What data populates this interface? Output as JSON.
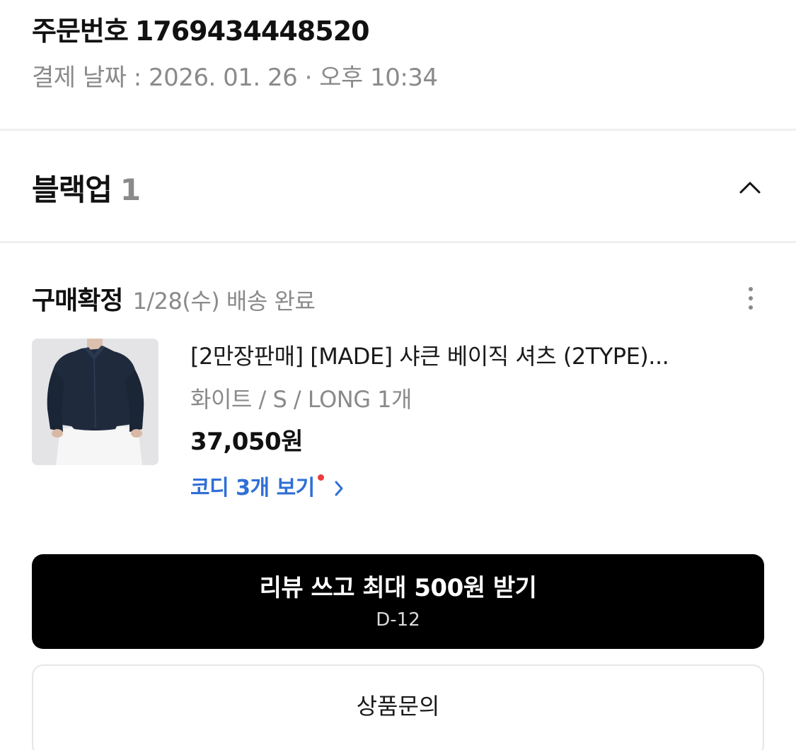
{
  "order": {
    "label": "주문번호",
    "number": "1769434448520",
    "date_text": "결제 날짜 : 2026. 01. 26 · 오후 10:34"
  },
  "shop": {
    "name": "블랙업",
    "count": "1"
  },
  "status": {
    "main": "구매확정",
    "sub": "1/28(수) 배송 완료"
  },
  "product": {
    "name": "[2만장판매] [MADE] 샤큰 베이직 셔츠 (2TYPE)...",
    "option": "화이트 / S / LONG 1개",
    "price": "37,050원",
    "coordi_link": "코디 3개 보기"
  },
  "buttons": {
    "review_main": "리뷰 쓰고 최대 500원 받기",
    "review_sub": "D-12",
    "inquiry": "상품문의"
  },
  "colors": {
    "link": "#2f6fd6",
    "badge_dot": "#ee3b3b",
    "primary_button": "#000000",
    "muted_text": "#8a8a8a"
  },
  "icons": [
    "chevron-up-icon",
    "more-vertical-icon",
    "chevron-right-icon"
  ]
}
